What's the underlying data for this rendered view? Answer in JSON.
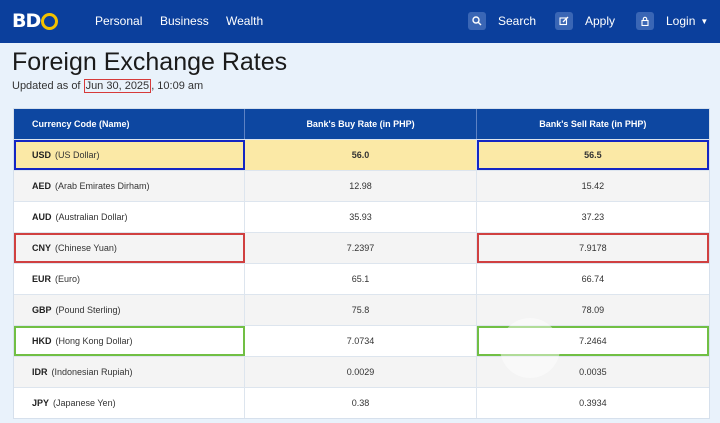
{
  "nav": {
    "logo_text": "BD",
    "links": [
      "Personal",
      "Business",
      "Wealth"
    ],
    "search_label": "Search",
    "apply_label": "Apply",
    "login_label": "Login"
  },
  "page": {
    "title": "Foreign Exchange Rates",
    "updated_prefix": "Updated as of ",
    "updated_date": "Jun 30, 2025",
    "updated_time": ", 10:09 am"
  },
  "table": {
    "headers": [
      "Currency Code (Name)",
      "Bank's Buy Rate (in PHP)",
      "Bank's Sell Rate (in PHP)"
    ],
    "rows": [
      {
        "code": "USD",
        "name": "(US Dollar)",
        "buy": "56.0",
        "sell": "56.5"
      },
      {
        "code": "AED",
        "name": "(Arab Emirates Dirham)",
        "buy": "12.98",
        "sell": "15.42"
      },
      {
        "code": "AUD",
        "name": "(Australian Dollar)",
        "buy": "35.93",
        "sell": "37.23"
      },
      {
        "code": "CNY",
        "name": "(Chinese Yuan)",
        "buy": "7.2397",
        "sell": "7.9178"
      },
      {
        "code": "EUR",
        "name": "(Euro)",
        "buy": "65.1",
        "sell": "66.74"
      },
      {
        "code": "GBP",
        "name": "(Pound Sterling)",
        "buy": "75.8",
        "sell": "78.09"
      },
      {
        "code": "HKD",
        "name": "(Hong Kong Dollar)",
        "buy": "7.0734",
        "sell": "7.2464"
      },
      {
        "code": "IDR",
        "name": "(Indonesian Rupiah)",
        "buy": "0.0029",
        "sell": "0.0035"
      },
      {
        "code": "JPY",
        "name": "(Japanese Yen)",
        "buy": "0.38",
        "sell": "0.3934"
      }
    ]
  },
  "colors": {
    "nav_bg": "#0b3f9c",
    "header_bg": "#0d47a1",
    "highlight_row": "#fbe9a6",
    "annotation_blue": "#1326c4",
    "annotation_red": "#d04040",
    "annotation_green": "#71bf44"
  }
}
